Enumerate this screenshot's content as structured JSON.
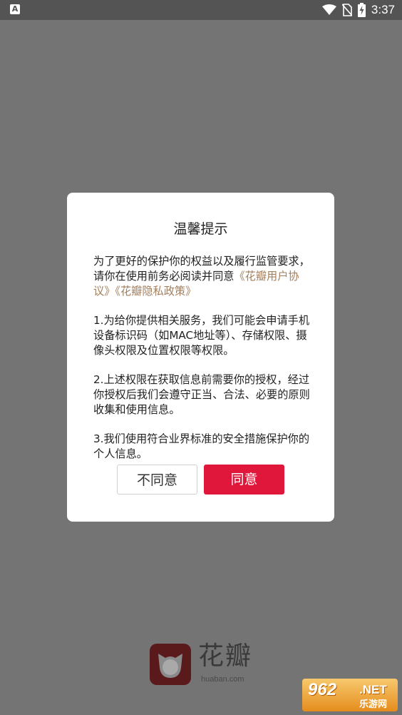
{
  "status_bar": {
    "left_icon_label": "A",
    "time": "3:37"
  },
  "dialog": {
    "title": "温馨提示",
    "intro_prefix": "为了更好的保护你的权益以及履行监管要求，请你在使用前务必阅读并同意",
    "link_user_agreement": "《花瓣用户协议》",
    "link_privacy_policy": "《花瓣隐私政策》",
    "point1": "1.为给你提供相关服务，我们可能会申请手机设备标识码（如MAC地址等）、存储权限、摄像头权限及位置权限等权限。",
    "point2": "2.上述权限在获取信息前需要你的授权，经过你授权后我们会遵守正当、合法、必要的原则收集和使用信息。",
    "point3": "3.我们使用符合业界标准的安全措施保护你的个人信息。",
    "disagree_label": "不同意",
    "agree_label": "同意"
  },
  "brand": {
    "name": "花瓣",
    "domain": "huaban.com"
  },
  "watermark": {
    "number": "962",
    "net": ".NET",
    "cn": "乐游网"
  },
  "colors": {
    "overlay": "#747474",
    "status_bar": "#545454",
    "accent": "#E0173A",
    "link": "#A37F5E"
  }
}
